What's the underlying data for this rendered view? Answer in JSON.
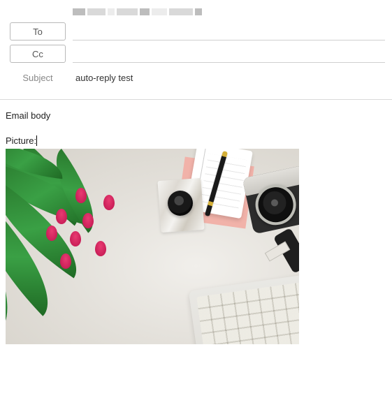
{
  "header": {
    "to_label": "To",
    "cc_label": "Cc",
    "subject_label": "Subject",
    "to_value": "",
    "cc_value": "",
    "subject_value": "auto-reply test"
  },
  "body": {
    "line1": "Email body",
    "picture_label": "Picture:"
  }
}
